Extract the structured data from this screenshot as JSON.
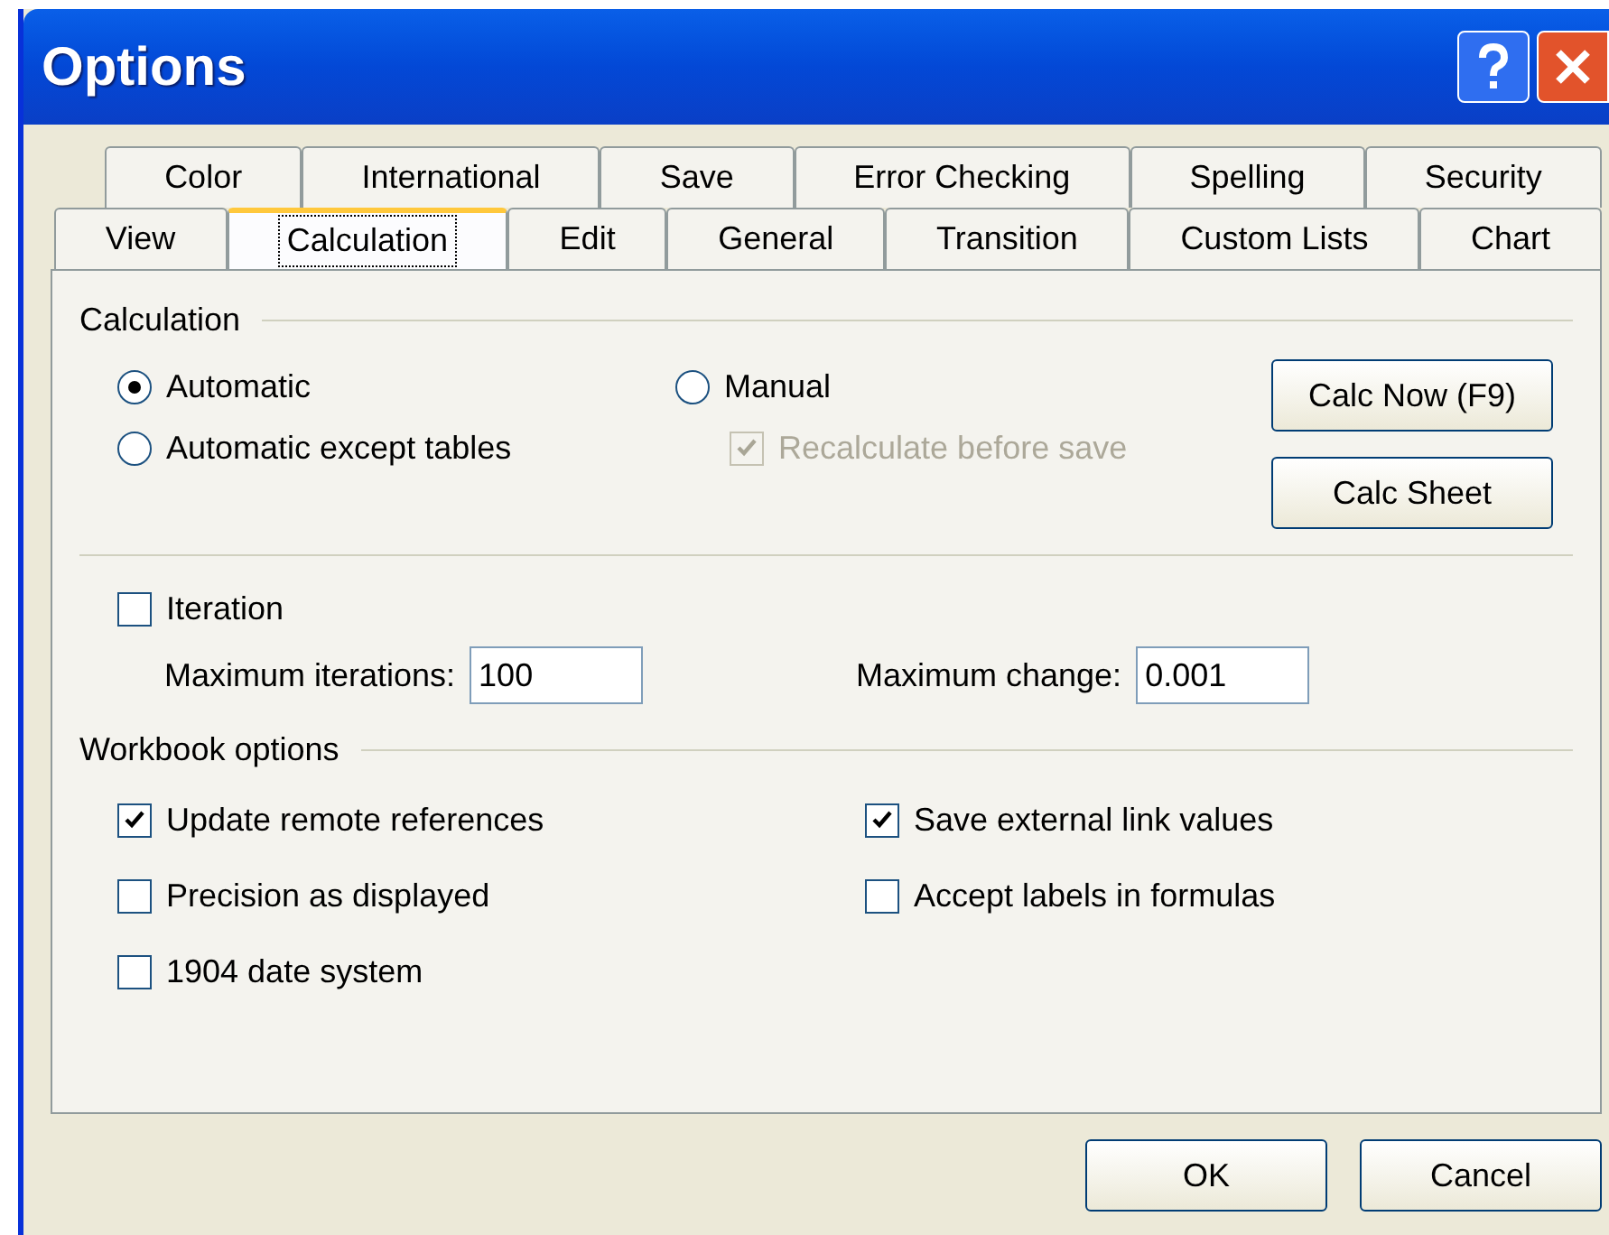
{
  "window": {
    "title": "Options"
  },
  "tab_rows": [
    [
      {
        "label": "Color",
        "selected": false
      },
      {
        "label": "International",
        "selected": false
      },
      {
        "label": "Save",
        "selected": false
      },
      {
        "label": "Error Checking",
        "selected": false
      },
      {
        "label": "Spelling",
        "selected": false
      },
      {
        "label": "Security",
        "selected": false
      }
    ],
    [
      {
        "label": "View",
        "selected": false
      },
      {
        "label": "Calculation",
        "selected": true
      },
      {
        "label": "Edit",
        "selected": false
      },
      {
        "label": "General",
        "selected": false
      },
      {
        "label": "Transition",
        "selected": false
      },
      {
        "label": "Custom Lists",
        "selected": false
      },
      {
        "label": "Chart",
        "selected": false
      }
    ]
  ],
  "calculation": {
    "heading": "Calculation",
    "radios": [
      {
        "label": "Automatic",
        "selected": true
      },
      {
        "label": "Automatic except tables",
        "selected": false
      },
      {
        "label": "Manual",
        "selected": false
      }
    ],
    "recalculate": {
      "label": "Recalculate before save",
      "checked": true,
      "disabled": true
    },
    "buttons": [
      "Calc Now (F9)",
      "Calc Sheet"
    ]
  },
  "iteration": {
    "label": "Iteration",
    "checked": false
  },
  "fields": [
    {
      "label": "Maximum iterations:",
      "value": "100"
    },
    {
      "label": "Maximum change:",
      "value": "0.001"
    }
  ],
  "workbook": {
    "heading": "Workbook options",
    "options": [
      {
        "label": "Update remote references",
        "checked": true
      },
      {
        "label": "Save external link values",
        "checked": true
      },
      {
        "label": "Precision as displayed",
        "checked": false
      },
      {
        "label": "Accept labels in formulas",
        "checked": false
      },
      {
        "label": "1904 date system",
        "checked": false
      }
    ]
  },
  "buttons": [
    "OK",
    "Cancel"
  ]
}
